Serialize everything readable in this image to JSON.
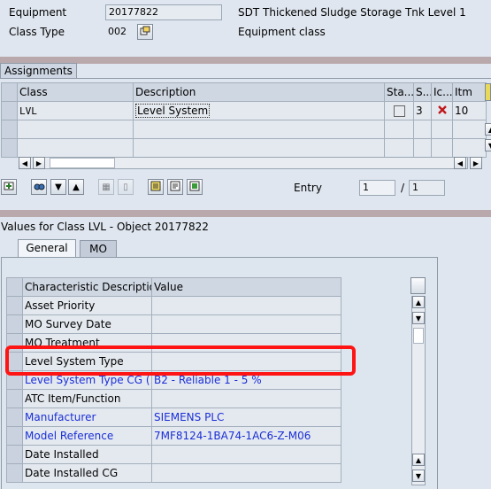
{
  "header": {
    "equipment_label": "Equipment",
    "equipment_value": "20177822",
    "equipment_desc": "SDT Thickened Sludge Storage Tnk Level 1",
    "class_type_label": "Class Type",
    "class_type_value": "002",
    "class_type_desc": "Equipment class"
  },
  "assignments": {
    "title": "Assignments",
    "columns": [
      "Class",
      "Description",
      "Sta...",
      "S...",
      "Ic...",
      "Itm"
    ],
    "rows": [
      {
        "class": "LVL",
        "description": "Level System",
        "status": "",
        "s": "3",
        "item": "10"
      }
    ]
  },
  "toolbar": {
    "entry_label": "Entry",
    "entry_value": "1",
    "entry_sep": "/",
    "entry_total": "1"
  },
  "values": {
    "title": "Values for Class LVL - Object 20177822",
    "tabs": [
      "General",
      "MO"
    ],
    "columns": [
      "Characteristic Description",
      "Value"
    ],
    "rows": [
      {
        "desc": "Asset Priority",
        "value": ""
      },
      {
        "desc": "MO Survey Date",
        "value": ""
      },
      {
        "desc": "MO Treatment",
        "value": ""
      },
      {
        "desc": "Level System Type",
        "value": ""
      },
      {
        "desc": "Level System Type CG (...",
        "value": "B2 - Reliable 1 - 5 %"
      },
      {
        "desc": "ATC Item/Function",
        "value": ""
      },
      {
        "desc": "Manufacturer",
        "value": "SIEMENS PLC"
      },
      {
        "desc": "Model Reference",
        "value": "7MF8124-1BA74-1AC6-Z-M06"
      },
      {
        "desc": "Date Installed",
        "value": ""
      },
      {
        "desc": "Date Installed CG",
        "value": ""
      }
    ]
  },
  "colors": {
    "highlight": "#ff1414",
    "link_text": "#1a2ed8"
  }
}
